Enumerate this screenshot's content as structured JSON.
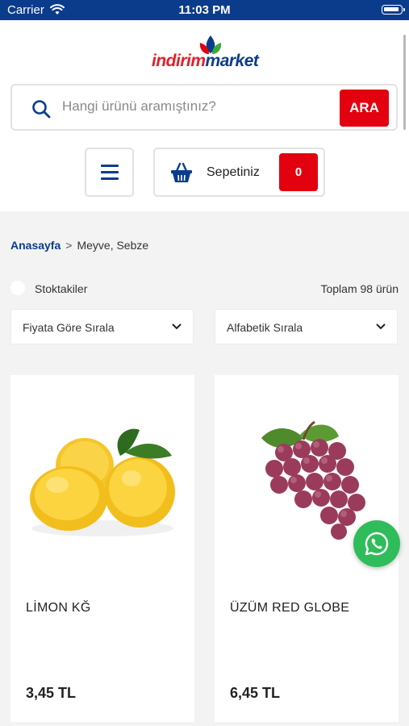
{
  "status_bar": {
    "carrier": "Carrier",
    "time": "11:03 PM"
  },
  "brand": {
    "name_part1": "indirim",
    "name_part2": "market",
    "primary_color": "#0b3c8c",
    "accent_color": "#e3000f"
  },
  "search": {
    "placeholder": "Hangi ürünü aramıştınız?",
    "button_label": "ARA"
  },
  "menu": {
    "icon": "hamburger-menu-icon"
  },
  "cart": {
    "label": "Sepetiniz",
    "count": "0",
    "icon": "basket-icon"
  },
  "breadcrumb": {
    "home": "Anasayfa",
    "separator": ">",
    "current": "Meyve, Sebze"
  },
  "filters": {
    "in_stock_label": "Stoktakiler",
    "total_label": "Toplam 98 ürün",
    "sort_price": "Fiyata Göre Sırala",
    "sort_alpha": "Alfabetik Sırala"
  },
  "products": [
    {
      "name": "LİMON KĞ",
      "price": "3,45 TL",
      "image": "lemon-image"
    },
    {
      "name": "ÜZÜM RED GLOBE",
      "price": "6,45 TL",
      "image": "grapes-image"
    }
  ],
  "whatsapp": {
    "icon": "whatsapp-icon",
    "color": "#2ebd5a"
  }
}
